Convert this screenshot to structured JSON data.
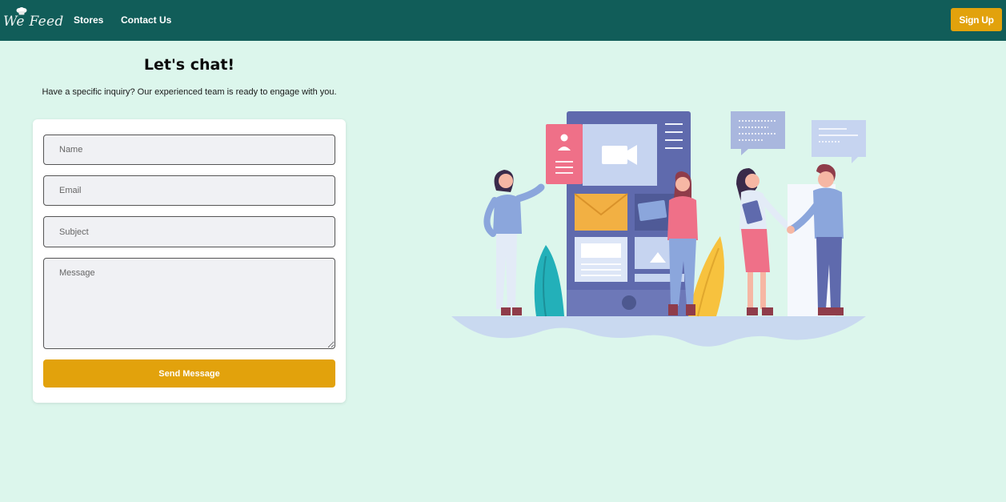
{
  "nav": {
    "logo_text": "We Feed",
    "links": [
      "Stores",
      "Contact Us"
    ],
    "signup_label": "Sign Up"
  },
  "page": {
    "title": "Let's chat!",
    "subtitle": "Have a specific inquiry? Our experienced team is ready to engage with you."
  },
  "form": {
    "name_placeholder": "Name",
    "email_placeholder": "Email",
    "subject_placeholder": "Subject",
    "message_placeholder": "Message",
    "send_label": "Send Message"
  },
  "colors": {
    "nav_bg": "#115d59",
    "page_bg": "#dcf6ec",
    "accent": "#e2a20c",
    "card_bg": "#ffffff"
  },
  "icons": [
    "chef-hat-icon",
    "contact-illustration"
  ]
}
